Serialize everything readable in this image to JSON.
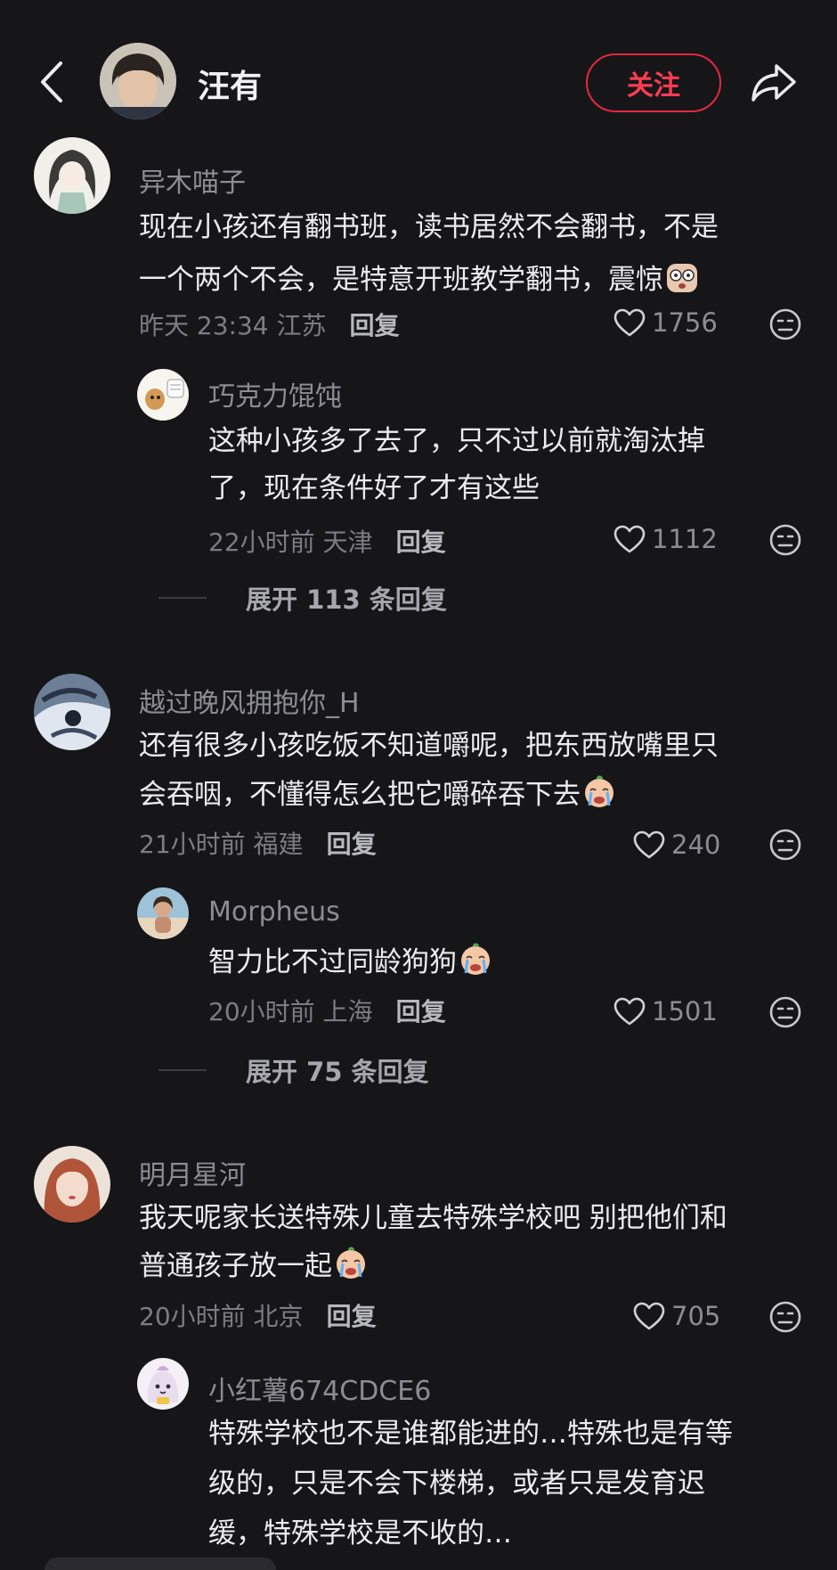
{
  "header": {
    "author_name": "汪有",
    "follow_label": "关注",
    "back_icon": "chevron-left-icon",
    "share_icon": "share-arrow-icon"
  },
  "colors": {
    "background": "#161619",
    "accent": "#e5283f",
    "text_primary": "#ececee",
    "text_secondary": "#8c8c94"
  },
  "comments": [
    {
      "username": "异木喵子",
      "text_lines": [
        "现在小孩还有翻书班，读书居然不会翻书，不是",
        "一个两个不会，是特意开班教学翻书，震惊"
      ],
      "emoji": "shocked-emoji",
      "time": "昨天 23:34",
      "location": "江苏",
      "reply_label": "回复",
      "likes": "1756",
      "replies": [
        {
          "username": "巧克力馄饨",
          "text_lines": [
            "这种小孩多了去了，只不过以前就淘汰掉",
            "了，现在条件好了才有这些"
          ],
          "time": "22小时前",
          "location": "天津",
          "reply_label": "回复",
          "likes": "1112"
        }
      ],
      "expand_label": "展开 113 条回复"
    },
    {
      "username": "越过晚风拥抱你_H",
      "text_lines": [
        "还有很多小孩吃饭不知道嚼呢，把东西放嘴里只",
        "会吞咽，不懂得怎么把它嚼碎吞下去"
      ],
      "emoji": "crying-emoji",
      "time": "21小时前",
      "location": "福建",
      "reply_label": "回复",
      "likes": "240",
      "replies": [
        {
          "username": "Morpheus",
          "text_lines": [
            "智力比不过同龄狗狗"
          ],
          "emoji": "crying-emoji",
          "time": "20小时前",
          "location": "上海",
          "reply_label": "回复",
          "likes": "1501"
        }
      ],
      "expand_label": "展开 75 条回复"
    },
    {
      "username": "明月星河",
      "text_lines": [
        "我天呢家长送特殊儿童去特殊学校吧 别把他们和",
        "普通孩子放一起"
      ],
      "emoji": "crying-emoji",
      "time": "20小时前",
      "location": "北京",
      "reply_label": "回复",
      "likes": "705",
      "replies": [
        {
          "username": "小红薯674CDCE6",
          "text_lines": [
            "特殊学校也不是谁都能进的…特殊也是有等",
            "级的，只是不会下楼梯，或者只是发育迟",
            "缓，特殊学校是不收的…"
          ]
        }
      ]
    }
  ]
}
